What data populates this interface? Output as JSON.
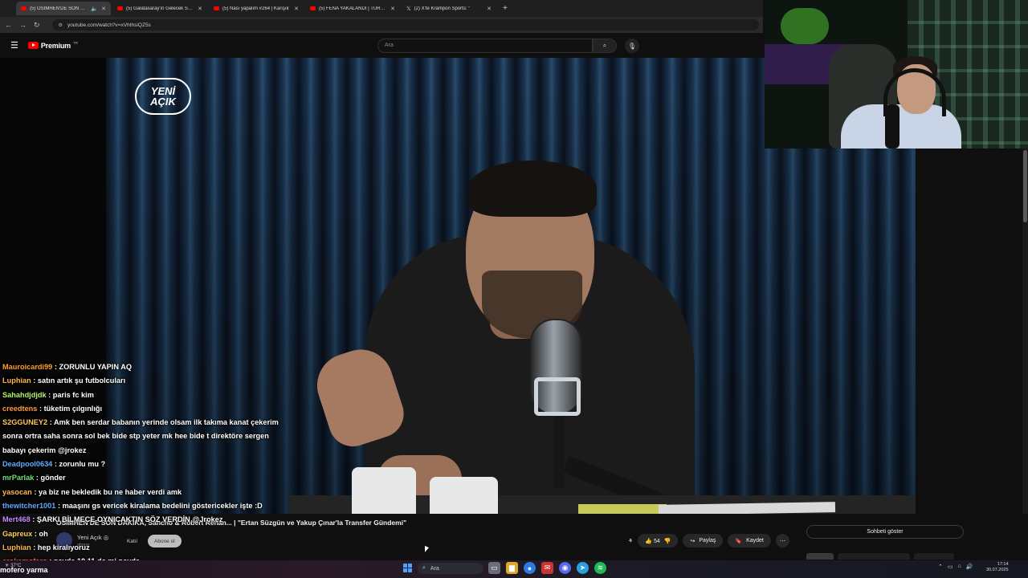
{
  "browser": {
    "tabs": [
      {
        "title": "(5) OSIMHEN'DE SON DAKİ",
        "favicon": "youtube-icon",
        "active": true
      },
      {
        "title": "(5) Galatasaray'ın Gelecek Sezo",
        "favicon": "youtube-icon",
        "active": false
      },
      {
        "title": "(5) Nası yapalım #264 | Karışık",
        "favicon": "youtube-icon",
        "active": false
      },
      {
        "title": "(5) FENA YAKALANDI | TÜRKİYE",
        "favicon": "youtube-icon",
        "active": false
      },
      {
        "title": "(2) X'te Krampon Sports: \"",
        "favicon": "x-icon",
        "active": false
      }
    ],
    "new_tab": "+",
    "url": "youtube.com/watch?v=xVhthsiQZ5s"
  },
  "yt": {
    "brand": "Premium",
    "brand_sup": "TR",
    "search_placeholder": "Ara"
  },
  "video": {
    "logo_line1": "YENİ",
    "logo_line2": "AÇIK",
    "title": "OSIMHEN'DE SON DAKİKA, Sancho & Robert Renan... | \"Ertan Süzgün ve Yakup Çınar'la Transfer Gündemi\"",
    "channel": "Yeni Açık",
    "channel_sub": "abone",
    "join_label": "Katıl",
    "subscribe_label": "Abone ol",
    "like_count": "54",
    "share_label": "Paylaş",
    "save_label": "Kaydet",
    "show_chat_label": "Sohbeti göster"
  },
  "chat": [
    {
      "user": "Mauroicardi99",
      "color": "#ff9f2f",
      "text": "ZORUNLU YAPIN AQ"
    },
    {
      "user": "Luphian",
      "color": "#ffb84a",
      "text": "satın artık şu futbolcuları"
    },
    {
      "user": "Sahahdjdjdk",
      "color": "#b5f26a",
      "text": "paris fc kim"
    },
    {
      "user": "creedtens",
      "color": "#ff9a3a",
      "text": "tüketim çılgınlığı"
    },
    {
      "user": "S2GGUNEY2",
      "color": "#ffc658",
      "text": "Amk ben serdar babanın yerinde olsam ilk takıma kanat çekerim sonra ortra saha sonra sol bek bide stp yeter mk hee bide t direktöre sergen babayı çekerim @jrokez"
    },
    {
      "user": "Deadpool0634",
      "color": "#5fb0ff",
      "text": "zorunlu mu ?"
    },
    {
      "user": "mrParlak",
      "color": "#6fe07a",
      "text": "gönder"
    },
    {
      "user": "yasocan",
      "color": "#ffb84a",
      "text": "ya biz ne bekledik bu ne haber verdi amk"
    },
    {
      "user": "thewitcher1001",
      "color": "#63a8ff",
      "text": "maaşını gs vericek kiralama bedelini göstericekler işte :D"
    },
    {
      "user": "Mert468",
      "color": "#c78cff",
      "text": "ŞARKI BİLMECE OYNICAKTIN SÖZ VERDİN @Jrokez"
    },
    {
      "user": "Gapreux",
      "color": "#ffd35a",
      "text": "oh"
    },
    {
      "user": "Luphian",
      "color": "#ffb84a",
      "text": "hep kiralıyoruz"
    },
    {
      "user": "erokemofero",
      "color": "#ff5a5a",
      "text": "neyde 10 11 de mi neyde"
    }
  ],
  "ticker": "mofero yarma",
  "taskbar": {
    "weather": "37°C",
    "search_label": "Ara",
    "time": "17:14",
    "date": "30.07.2025"
  }
}
